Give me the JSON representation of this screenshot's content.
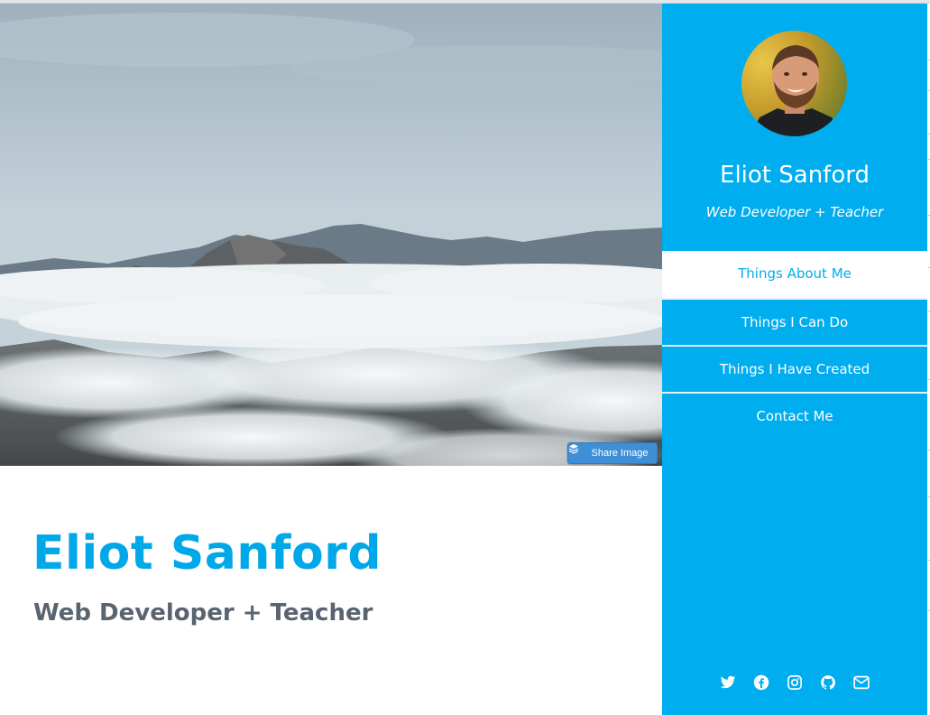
{
  "hero": {
    "share_label": "Share Image",
    "share_icon": "layers-icon"
  },
  "main": {
    "title": "Eliot Sanford",
    "subtitle": "Web Developer + Teacher"
  },
  "sidebar": {
    "name": "Eliot Sanford",
    "role": "Web Developer + Teacher",
    "nav": [
      {
        "label": "Things About Me",
        "active": true
      },
      {
        "label": "Things I Can Do",
        "active": false
      },
      {
        "label": "Things I Have Created",
        "active": false
      },
      {
        "label": "Contact Me",
        "active": false
      }
    ],
    "socials": [
      "twitter-icon",
      "facebook-icon",
      "instagram-icon",
      "github-icon",
      "email-icon"
    ]
  },
  "colors": {
    "accent": "#00adef",
    "title": "#00a8e8",
    "subtitle": "#5a6470",
    "share_button": "#3f8fd6"
  }
}
